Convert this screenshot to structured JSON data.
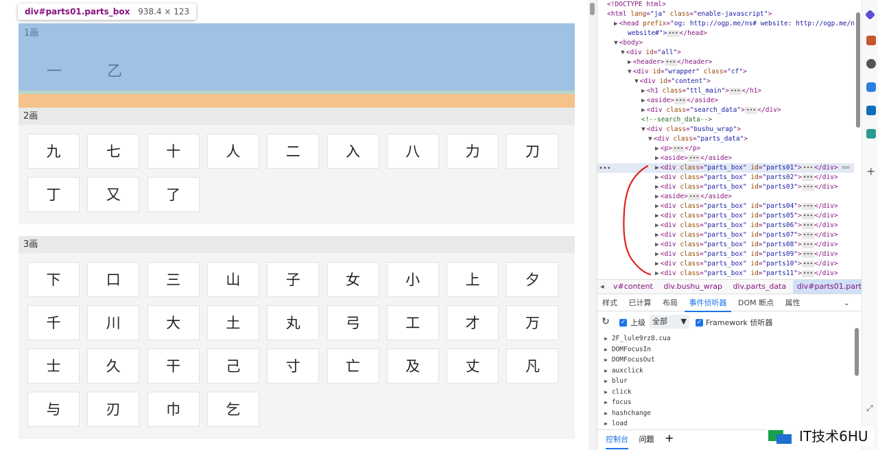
{
  "inspect_tooltip": {
    "selector": "div#parts01.parts_box",
    "size": "938.4 × 123"
  },
  "sections": [
    {
      "header": "1画",
      "kanji": [
        "一",
        "乙"
      ]
    },
    {
      "header": "2画",
      "kanji": [
        "九",
        "七",
        "十",
        "人",
        "二",
        "入",
        "八",
        "力",
        "刀",
        "丁",
        "又",
        "了"
      ]
    },
    {
      "header": "3画",
      "kanji": [
        "下",
        "口",
        "三",
        "山",
        "子",
        "女",
        "小",
        "上",
        "夕",
        "千",
        "川",
        "大",
        "土",
        "丸",
        "弓",
        "工",
        "才",
        "万",
        "士",
        "久",
        "干",
        "己",
        "寸",
        "亡",
        "及",
        "丈",
        "凡",
        "与",
        "刃",
        "巾",
        "乞"
      ]
    }
  ],
  "dom_tree": [
    {
      "indent": 0,
      "tw": "",
      "open": "<!DOCTYPE html>"
    },
    {
      "indent": 0,
      "tw": "",
      "tag": "html",
      "attrs": [
        [
          "lang",
          "ja"
        ],
        [
          "class",
          "enable-javascript"
        ]
      ]
    },
    {
      "indent": 1,
      "tw": "▶",
      "tag": "head",
      "attrs": [
        [
          "prefix",
          "og: http://ogp.me/ns# website: http://ogp.me/ns/"
        ]
      ],
      "close": ""
    },
    {
      "indent": 3,
      "tw": "",
      "raw": "website#\">",
      "close": "head"
    },
    {
      "indent": 1,
      "tw": "▼",
      "tag": "body",
      "attrs": []
    },
    {
      "indent": 2,
      "tw": "▼",
      "tag": "div",
      "attrs": [
        [
          "id",
          "all"
        ]
      ]
    },
    {
      "indent": 3,
      "tw": "▶",
      "tag": "header",
      "attrs": [],
      "close": "header"
    },
    {
      "indent": 3,
      "tw": "▼",
      "tag": "div",
      "attrs": [
        [
          "id",
          "wrapper"
        ],
        [
          "class",
          "cf"
        ]
      ]
    },
    {
      "indent": 4,
      "tw": "▼",
      "tag": "div",
      "attrs": [
        [
          "id",
          "content"
        ]
      ]
    },
    {
      "indent": 5,
      "tw": "▶",
      "tag": "h1",
      "attrs": [
        [
          "class",
          "ttl_main"
        ]
      ],
      "close": "h1"
    },
    {
      "indent": 5,
      "tw": "▶",
      "tag": "aside",
      "attrs": [],
      "close": "aside"
    },
    {
      "indent": 5,
      "tw": "▶",
      "tag": "div",
      "attrs": [
        [
          "class",
          "search_data"
        ]
      ],
      "close": "div"
    },
    {
      "indent": 5,
      "tw": "",
      "comment": "<!--search_data-->"
    },
    {
      "indent": 5,
      "tw": "▼",
      "tag": "div",
      "attrs": [
        [
          "class",
          "bushu_wrap"
        ]
      ]
    },
    {
      "indent": 6,
      "tw": "▼",
      "tag": "div",
      "attrs": [
        [
          "class",
          "parts_data"
        ]
      ]
    },
    {
      "indent": 7,
      "tw": "▶",
      "tag": "p",
      "attrs": [],
      "close": "p"
    },
    {
      "indent": 7,
      "tw": "▶",
      "tag": "aside",
      "attrs": [],
      "close": "aside"
    },
    {
      "indent": 7,
      "tw": "▶",
      "tag": "div",
      "attrs": [
        [
          "class",
          "parts_box"
        ],
        [
          "id",
          "parts01"
        ]
      ],
      "close": "div",
      "suffix": " == $0",
      "selected": true
    },
    {
      "indent": 7,
      "tw": "▶",
      "tag": "div",
      "attrs": [
        [
          "class",
          "parts_box"
        ],
        [
          "id",
          "parts02"
        ]
      ],
      "close": "div"
    },
    {
      "indent": 7,
      "tw": "▶",
      "tag": "div",
      "attrs": [
        [
          "class",
          "parts_box"
        ],
        [
          "id",
          "parts03"
        ]
      ],
      "close": "div"
    },
    {
      "indent": 7,
      "tw": "▶",
      "tag": "aside",
      "attrs": [],
      "close": "aside"
    },
    {
      "indent": 7,
      "tw": "▶",
      "tag": "div",
      "attrs": [
        [
          "class",
          "parts_box"
        ],
        [
          "id",
          "parts04"
        ]
      ],
      "close": "div"
    },
    {
      "indent": 7,
      "tw": "▶",
      "tag": "div",
      "attrs": [
        [
          "class",
          "parts_box"
        ],
        [
          "id",
          "parts05"
        ]
      ],
      "close": "div"
    },
    {
      "indent": 7,
      "tw": "▶",
      "tag": "div",
      "attrs": [
        [
          "class",
          "parts_box"
        ],
        [
          "id",
          "parts06"
        ]
      ],
      "close": "div"
    },
    {
      "indent": 7,
      "tw": "▶",
      "tag": "div",
      "attrs": [
        [
          "class",
          "parts_box"
        ],
        [
          "id",
          "parts07"
        ]
      ],
      "close": "div"
    },
    {
      "indent": 7,
      "tw": "▶",
      "tag": "div",
      "attrs": [
        [
          "class",
          "parts_box"
        ],
        [
          "id",
          "parts08"
        ]
      ],
      "close": "div"
    },
    {
      "indent": 7,
      "tw": "▶",
      "tag": "div",
      "attrs": [
        [
          "class",
          "parts_box"
        ],
        [
          "id",
          "parts09"
        ]
      ],
      "close": "div"
    },
    {
      "indent": 7,
      "tw": "▶",
      "tag": "div",
      "attrs": [
        [
          "class",
          "parts_box"
        ],
        [
          "id",
          "parts10"
        ]
      ],
      "close": "div"
    },
    {
      "indent": 7,
      "tw": "▶",
      "tag": "div",
      "attrs": [
        [
          "class",
          "parts_box"
        ],
        [
          "id",
          "parts11"
        ]
      ],
      "close": "div"
    }
  ],
  "breadcrumbs": [
    "v#content",
    "div.bushu_wrap",
    "div.parts_data",
    "div#parts01.parts_box"
  ],
  "panel_tabs": [
    "样式",
    "已计算",
    "布局",
    "事件侦听器",
    "DOM 断点",
    "属性"
  ],
  "active_panel_tab": "事件侦听器",
  "listener_toolbar": {
    "ancestors_label": "上级",
    "filter_value": "全部",
    "framework_label": "Framework 侦听器"
  },
  "events": [
    "2F_lule9rz8.cua",
    "DOMFocusIn",
    "DOMFocusOut",
    "auxclick",
    "blur",
    "click",
    "focus",
    "hashchange",
    "load"
  ],
  "bottom_tabs": [
    "控制台",
    "问题"
  ],
  "watermark": "IT技术6HU",
  "colors": {
    "highlight_content": "#9fc1e3",
    "highlight_margin": "#f5c28c",
    "accent": "#1a73e8",
    "annotation_red": "#e0201b"
  }
}
